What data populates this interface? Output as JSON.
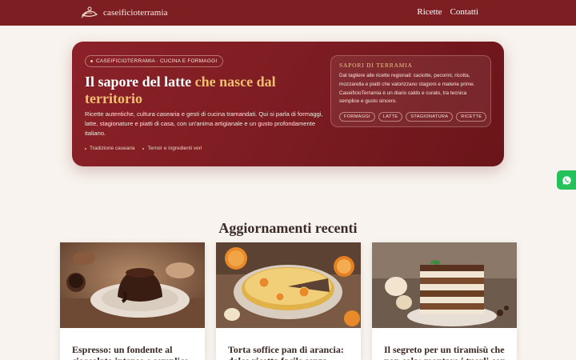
{
  "header": {
    "logo_text": "caseificioterramia",
    "logo_icon": "cheese-knife-icon",
    "nav": [
      {
        "label": "Ricette"
      },
      {
        "label": "Contatti"
      }
    ],
    "bar_color": "#7d1f22"
  },
  "hero": {
    "badge": "CASEIFICIOTERRAMIA · CUCINA E FORMAGGI",
    "title_main": "Il sapore del latte ",
    "title_accent": "che nasce dal territorio",
    "description": "Ricette autentiche, cultura casearia e gesti di cucina tramandati. Qui si parla di formaggi, latte, stagionature e piatti di casa, con un'anima artigianale e un gusto profondamente italiano.",
    "tags": [
      "Tradizione casearia",
      "Terroir e ingredienti veri"
    ],
    "side_card": {
      "title": "SAPORI DI TERRAMIA",
      "text": "Dal tagliere alle ricette regionali: caciotte, pecorini, ricotta, mozzarella e piatti che valorizzano stagioni e materie prime. CaseificioTerramia è un diario caldo e curato, tra tecnica semplice e gusto sincero.",
      "chips": [
        "FORMAGGI",
        "LATTE",
        "STAGIONATURA",
        "RICETTE"
      ]
    },
    "accent_color": "#f3c070"
  },
  "floating": {
    "whatsapp_icon": "whatsapp-icon",
    "color": "#25c15a"
  },
  "recent": {
    "title": "Aggiornamenti recenti",
    "cards": [
      {
        "title": "Espresso: un fondente al cioccolato intenso e semplice",
        "image": "chocolate-fondant-image"
      },
      {
        "title": "Torta soffice pan di arancia: dolce ricetta facile senza",
        "image": "orange-cake-image"
      },
      {
        "title": "Il segreto per un tiramisù che non cola: montare i tuorli con",
        "image": "tiramisu-image"
      }
    ]
  }
}
